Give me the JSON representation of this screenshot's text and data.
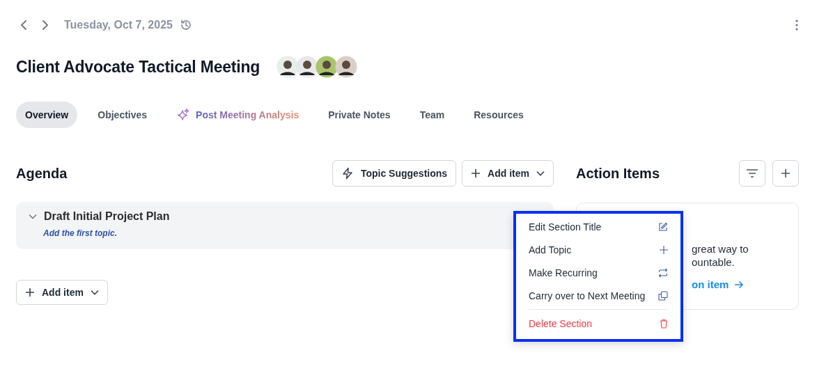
{
  "header": {
    "date": "Tuesday, Oct 7, 2025",
    "title": "Client Advocate Tactical Meeting",
    "attendees": [
      {
        "color": "#e6efe9"
      },
      {
        "color": "#e8e8ec"
      },
      {
        "color": "#a9c46a"
      },
      {
        "color": "#d9cfc9"
      }
    ]
  },
  "tabs": [
    {
      "label": "Overview",
      "selected": true,
      "kind": "plain"
    },
    {
      "label": "Objectives",
      "selected": false,
      "kind": "plain"
    },
    {
      "label": "Post Meeting Analysis",
      "selected": false,
      "kind": "ai"
    },
    {
      "label": "Private Notes",
      "selected": false,
      "kind": "plain"
    },
    {
      "label": "Team",
      "selected": false,
      "kind": "plain"
    },
    {
      "label": "Resources",
      "selected": false,
      "kind": "plain"
    }
  ],
  "agenda": {
    "title": "Agenda",
    "topic_suggestions": "Topic Suggestions",
    "add_item": "Add item",
    "sections": [
      {
        "title": "Draft Initial Project Plan",
        "expanded": true,
        "hint": "Add the first topic."
      }
    ],
    "bottom_add_item": "Add item"
  },
  "action_items": {
    "title": "Action Items",
    "empty_lines": [
      "great way to",
      "ountable."
    ],
    "link": "on item"
  },
  "menu": [
    {
      "label": "Edit Section Title",
      "kind": "edit"
    },
    {
      "label": "Add Topic",
      "kind": "add"
    },
    {
      "label": "Make Recurring",
      "kind": "repeat"
    },
    {
      "label": "Carry over to Next Meeting",
      "kind": "copy"
    },
    {
      "label": "Delete Section",
      "kind": "delete"
    }
  ]
}
